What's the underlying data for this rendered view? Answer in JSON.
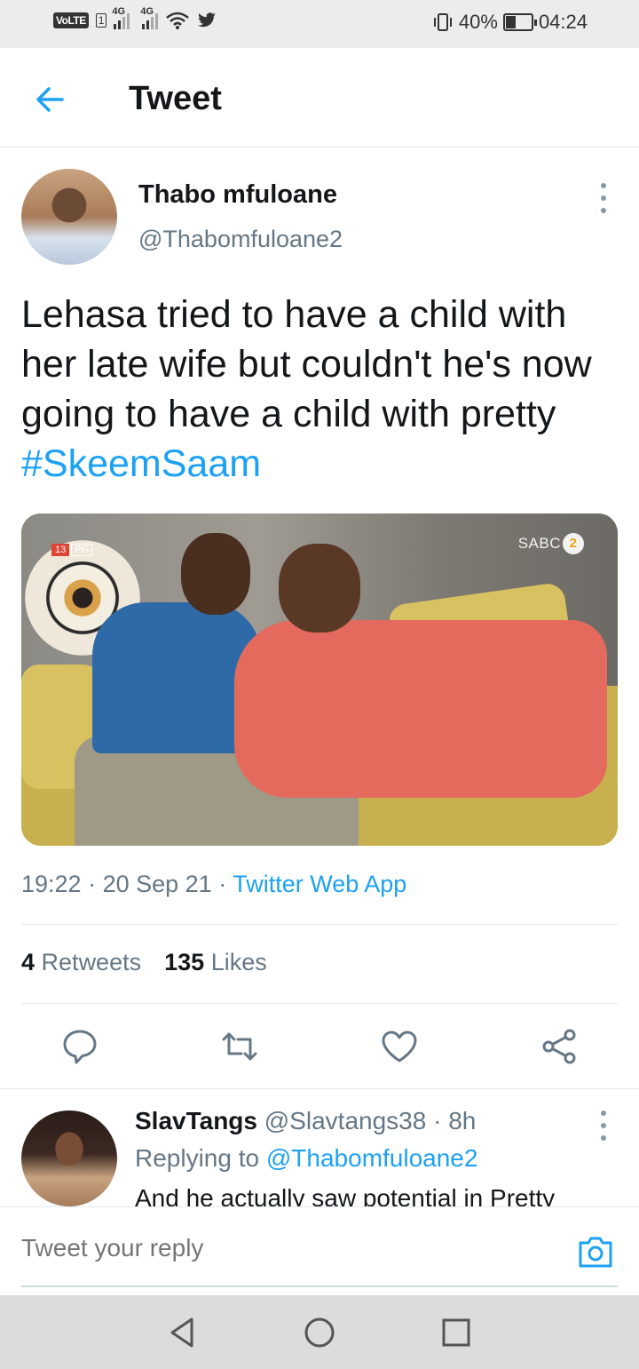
{
  "status_bar": {
    "volte": "VoLTE",
    "sim1_net": "4G",
    "sim2_net": "4G",
    "battery": "40%",
    "battery_level": 0.4,
    "time": "04:24"
  },
  "header": {
    "title": "Tweet"
  },
  "tweet": {
    "author_name": "Thabo mfuloane",
    "author_handle": "@Thabomfuloane2",
    "text": "Lehasa tried to have a child with her late wife but couldn't he's now going to have a child with pretty ",
    "hashtag": "#SkeemSaam",
    "media": {
      "rating_age": "13",
      "rating_pg": "PG",
      "channel": "SABC",
      "channel_number": "2"
    },
    "time": "19:22",
    "date": "20 Sep 21",
    "source": "Twitter Web App",
    "retweets_count": "4",
    "retweets_label": "Retweets",
    "likes_count": "135",
    "likes_label": "Likes"
  },
  "reply": {
    "name": "SlavTangs",
    "handle": "@Slavtangs38",
    "age": "8h",
    "replying_to_label": "Replying to",
    "replying_to": "@Thabomfuloane2",
    "text": "And he actually saw potential in Pretty"
  },
  "composer": {
    "placeholder": "Tweet your reply"
  },
  "colors": {
    "accent": "#1da1f2",
    "secondary_text": "#657786",
    "primary_text": "#14171a"
  }
}
